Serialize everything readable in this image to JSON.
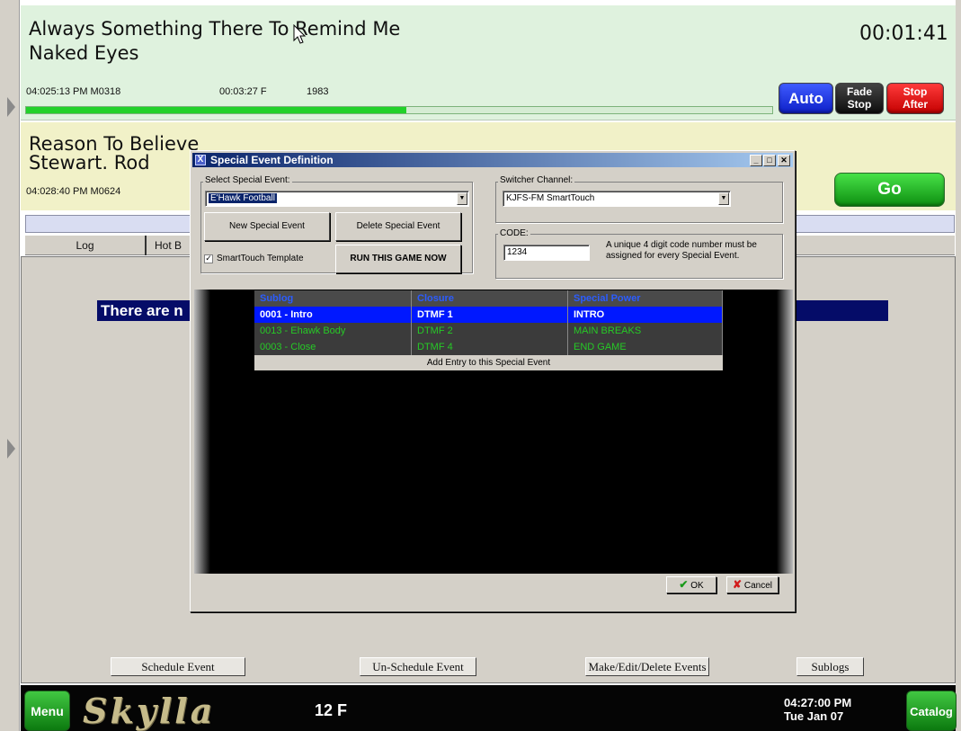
{
  "now_playing": {
    "title": "Always Something There To Remind Me",
    "artist": "Naked Eyes",
    "remaining": "00:01:41",
    "start_info": "04:025:13 PM M0318",
    "length": "00:03:27 F",
    "year": "1983",
    "progress": 0.51
  },
  "controls": {
    "auto": "Auto",
    "fade_1": "Fade",
    "fade_2": "Stop",
    "stop_1": "Stop",
    "stop_2": "After",
    "go": "Go"
  },
  "next_up": {
    "title": "Reason To Believe",
    "artist": "Stewart. Rod",
    "start_info": "04:028:40 PM M0624"
  },
  "tabs": [
    "Log",
    "Hot B"
  ],
  "message": "There are n",
  "bottom_buttons": {
    "schedule": "Schedule Event",
    "unschedule": "Un-Schedule Event",
    "make_edit": "Make/Edit/Delete Events",
    "sublogs": "Sublogs"
  },
  "footer": {
    "menu": "Menu",
    "logo": "Skylla",
    "temperature": "12 F",
    "time": "04:27:00 PM",
    "date": "Tue Jan 07",
    "catalog": "Catalog"
  },
  "dialog": {
    "title": "Special Event Definition",
    "select_label": "Select Special Event:",
    "select_value": "E'Hawk Football",
    "new_btn": "New Special Event",
    "delete_btn": "Delete Special Event",
    "template_label": "SmartTouch Template",
    "template_checked": true,
    "run_btn": "RUN THIS GAME NOW",
    "switcher_label": "Switcher Channel:",
    "switcher_value": "KJFS-FM SmartTouch",
    "code_label": "CODE:",
    "code_value": "1234",
    "code_help_1": "A unique 4 digit code number must be",
    "code_help_2": "assigned for every Special Event.",
    "grid": {
      "headers": [
        "Sublog",
        "Closure",
        "Special Power"
      ],
      "rows": [
        [
          "0001 - Intro",
          "DTMF 1",
          "INTRO"
        ],
        [
          "0013 - Ehawk Body",
          "DTMF 2",
          "MAIN BREAKS"
        ],
        [
          "0003 - Close",
          "DTMF 4",
          "END GAME"
        ]
      ],
      "add_entry": "Add Entry to this Special Event"
    },
    "ok": "OK",
    "cancel": "Cancel"
  }
}
